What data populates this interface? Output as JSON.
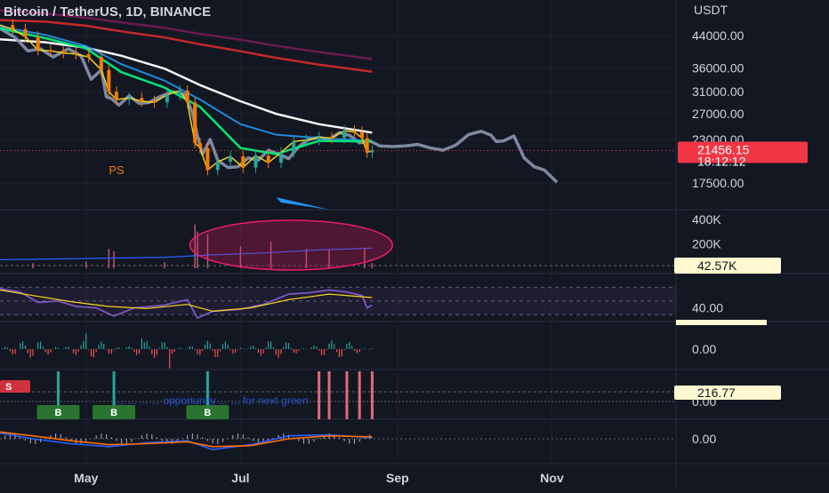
{
  "header": {
    "symbol_title": "Bitcoin / TetherUS, 1D, BINANCE"
  },
  "colors": {
    "background": "#131722",
    "text": "#d1d4dc",
    "price_line": "#8a96ad",
    "candle_up": "#26a69a",
    "candle_down": "#f57c00",
    "ma_white": "#f5f5f5",
    "ma_red": "#c62828",
    "ma_purple": "#6a1b4d",
    "ma_green": "#00e676",
    "ma_blue": "#2196f3",
    "ma_yellow": "#f9d71c",
    "volume_ellipse": "#e91e63",
    "rsi_line": "#7e57c2",
    "rsi_signal": "#f9d71c",
    "macd_line": "#2962ff",
    "signal_line": "#ff6d00",
    "price_badge": "#f23645",
    "label_badge": "#fff8d0"
  },
  "chart_data": [
    {
      "type": "line",
      "panel": "price",
      "title": "Bitcoin / TetherUS, 1D, BINANCE",
      "currency_label": "USDT",
      "yscale": "log",
      "ylim": [
        15000,
        52000
      ],
      "y_ticks": [
        44000,
        36000,
        31000,
        27000,
        23000,
        17500
      ],
      "y_tick_labels": [
        "44000.00",
        "36000.00",
        "31000.00",
        "27000.00",
        "23000.00",
        "17500.00"
      ],
      "x_tick_labels": [
        "May",
        "Jul",
        "Sep",
        "Nov"
      ],
      "x_ticks": [
        "2022-05-01",
        "2022-07-01",
        "2022-09-01",
        "2022-11-01"
      ],
      "xlim": [
        "2022-03-28",
        "2022-12-20"
      ],
      "last_price": "21456.15",
      "countdown": "18:12:12",
      "annotation": "PS",
      "series": [
        {
          "role": "projection_line",
          "dates": [
            "2022-03-28",
            "2022-04-03",
            "2022-04-08",
            "2022-04-13",
            "2022-04-18",
            "2022-04-24",
            "2022-04-29",
            "2022-05-03",
            "2022-05-07",
            "2022-05-09",
            "2022-05-11",
            "2022-05-14",
            "2022-05-18",
            "2022-05-22",
            "2022-05-26",
            "2022-05-30",
            "2022-06-04",
            "2022-06-09",
            "2022-06-12",
            "2022-06-14",
            "2022-06-16",
            "2022-06-19",
            "2022-06-22",
            "2022-06-26",
            "2022-06-30",
            "2022-07-04",
            "2022-07-08",
            "2022-07-12",
            "2022-07-16",
            "2022-07-20",
            "2022-07-24",
            "2022-07-28",
            "2022-08-01",
            "2022-08-05",
            "2022-08-09",
            "2022-08-13",
            "2022-08-17",
            "2022-08-21",
            "2022-08-25",
            "2022-08-30",
            "2022-09-04",
            "2022-09-09",
            "2022-09-14",
            "2022-09-19",
            "2022-09-24",
            "2022-09-29",
            "2022-10-04",
            "2022-10-08",
            "2022-10-10",
            "2022-10-13",
            "2022-10-17",
            "2022-10-21",
            "2022-10-25",
            "2022-10-29",
            "2022-11-03"
          ],
          "values": [
            46000,
            43500,
            40000,
            40500,
            38500,
            40500,
            38800,
            33500,
            35500,
            30000,
            29700,
            28500,
            30200,
            28800,
            29000,
            30000,
            31000,
            30500,
            27200,
            23500,
            21000,
            23000,
            20200,
            19300,
            19400,
            20500,
            20200,
            21500,
            21000,
            20400,
            22000,
            23000,
            23300,
            23000,
            24000,
            23600,
            22500,
            22800,
            22100,
            22000,
            22100,
            22300,
            21800,
            21500,
            22200,
            23700,
            24200,
            23600,
            22700,
            22800,
            23500,
            20500,
            19400,
            19000,
            17600
          ]
        },
        {
          "role": "close",
          "dates": [
            "2022-03-28",
            "2022-04-02",
            "2022-04-07",
            "2022-04-12",
            "2022-04-17",
            "2022-04-22",
            "2022-04-27",
            "2022-05-02",
            "2022-05-07",
            "2022-05-10",
            "2022-05-13",
            "2022-05-18",
            "2022-05-23",
            "2022-05-28",
            "2022-06-02",
            "2022-06-07",
            "2022-06-10",
            "2022-06-13",
            "2022-06-15",
            "2022-06-18",
            "2022-06-22",
            "2022-06-27",
            "2022-07-02",
            "2022-07-07",
            "2022-07-12",
            "2022-07-17",
            "2022-07-22",
            "2022-07-27",
            "2022-08-01",
            "2022-08-06",
            "2022-08-11",
            "2022-08-15",
            "2022-08-18",
            "2022-08-20",
            "2022-08-22"
          ],
          "values": [
            47000,
            45800,
            43700,
            40200,
            40000,
            39500,
            39200,
            38500,
            35500,
            31000,
            29500,
            29800,
            29200,
            29000,
            30400,
            31200,
            29000,
            22500,
            21800,
            19000,
            20000,
            20700,
            19300,
            20800,
            19900,
            21200,
            22700,
            22900,
            23300,
            23200,
            24300,
            24100,
            23200,
            21200,
            21456
          ]
        },
        {
          "role": "moving_average_white",
          "dates": [
            "2022-03-28",
            "2022-04-15",
            "2022-05-01",
            "2022-05-15",
            "2022-06-01",
            "2022-06-15",
            "2022-07-01",
            "2022-07-15",
            "2022-08-01",
            "2022-08-22"
          ],
          "values": [
            43000,
            42200,
            40800,
            38800,
            35800,
            32300,
            29200,
            27000,
            25300,
            24000
          ]
        },
        {
          "role": "moving_average_red",
          "dates": [
            "2022-03-28",
            "2022-04-15",
            "2022-05-01",
            "2022-05-15",
            "2022-06-01",
            "2022-06-15",
            "2022-07-01",
            "2022-07-15",
            "2022-08-01",
            "2022-08-22"
          ],
          "values": [
            48500,
            48000,
            46800,
            45200,
            43500,
            41700,
            39900,
            38300,
            36700,
            35100
          ]
        },
        {
          "role": "moving_average_purple",
          "dates": [
            "2022-03-28",
            "2022-04-15",
            "2022-05-01",
            "2022-05-15",
            "2022-06-01",
            "2022-06-15",
            "2022-07-01",
            "2022-07-15",
            "2022-08-01",
            "2022-08-22"
          ],
          "values": [
            51500,
            50500,
            49200,
            47800,
            46200,
            44500,
            42900,
            41300,
            39700,
            38000
          ]
        },
        {
          "role": "moving_average_blue",
          "dates": [
            "2022-03-28",
            "2022-04-15",
            "2022-05-01",
            "2022-05-15",
            "2022-06-01",
            "2022-06-15",
            "2022-07-01",
            "2022-07-15",
            "2022-08-01",
            "2022-08-22"
          ],
          "values": [
            46500,
            44200,
            41200,
            36800,
            33200,
            29500,
            25300,
            23700,
            23200,
            22800
          ]
        },
        {
          "role": "moving_average_green",
          "dates": [
            "2022-03-28",
            "2022-04-15",
            "2022-05-01",
            "2022-05-15",
            "2022-06-01",
            "2022-06-15",
            "2022-07-01",
            "2022-07-15",
            "2022-08-01",
            "2022-08-22"
          ],
          "values": [
            46000,
            43300,
            40600,
            35000,
            31800,
            28200,
            21800,
            21000,
            22800,
            22700
          ]
        }
      ]
    },
    {
      "type": "bar",
      "panel": "volume",
      "y_tick_labels": [
        "400K",
        "200K"
      ],
      "y_ticks": [
        400000,
        200000
      ],
      "ylim": [
        0,
        480000
      ],
      "last_value": "42.57K",
      "dates": [
        "2022-04-10",
        "2022-05-01",
        "2022-05-10",
        "2022-05-12",
        "2022-06-01",
        "2022-06-13",
        "2022-06-14",
        "2022-06-18",
        "2022-07-01",
        "2022-07-13",
        "2022-07-27",
        "2022-08-05",
        "2022-08-19",
        "2022-08-22"
      ],
      "values": [
        42000,
        55000,
        160000,
        140000,
        50000,
        360000,
        300000,
        280000,
        180000,
        220000,
        160000,
        150000,
        170000,
        42570
      ],
      "average": {
        "dates": [
          "2022-03-28",
          "2022-05-01",
          "2022-06-01",
          "2022-06-20",
          "2022-07-10",
          "2022-08-01",
          "2022-08-22"
        ],
        "values": [
          70000,
          80000,
          90000,
          110000,
          125000,
          150000,
          165000
        ]
      }
    },
    {
      "type": "line",
      "panel": "rsi",
      "y_tick_labels": [
        "40.00"
      ],
      "y_ticks": [
        40
      ],
      "ylim": [
        20,
        90
      ],
      "series": [
        {
          "role": "rsi",
          "dates": [
            "2022-03-28",
            "2022-04-05",
            "2022-04-12",
            "2022-04-20",
            "2022-04-27",
            "2022-05-05",
            "2022-05-12",
            "2022-05-20",
            "2022-06-01",
            "2022-06-10",
            "2022-06-14",
            "2022-06-20",
            "2022-07-01",
            "2022-07-10",
            "2022-07-20",
            "2022-07-28",
            "2022-08-05",
            "2022-08-12",
            "2022-08-18",
            "2022-08-20",
            "2022-08-22"
          ],
          "values": [
            68,
            63,
            48,
            50,
            42,
            40,
            28,
            40,
            44,
            52,
            25,
            35,
            38,
            45,
            60,
            62,
            66,
            63,
            58,
            40,
            44
          ]
        },
        {
          "role": "rsi_signal",
          "dates": [
            "2022-03-28",
            "2022-04-10",
            "2022-04-25",
            "2022-05-10",
            "2022-05-25",
            "2022-06-10",
            "2022-06-20",
            "2022-07-05",
            "2022-07-20",
            "2022-08-05",
            "2022-08-22"
          ],
          "values": [
            66,
            58,
            49,
            42,
            39,
            45,
            35,
            40,
            52,
            60,
            55
          ]
        }
      ]
    },
    {
      "type": "bar",
      "panel": "oscillator",
      "y_tick_labels": [
        "0.00"
      ],
      "y_ticks": [
        0
      ],
      "ylim": [
        -1,
        1
      ]
    },
    {
      "type": "bar",
      "panel": "signals",
      "y_tick_labels": [
        "0.00"
      ],
      "y_ticks": [
        0
      ],
      "last_value": "216.77",
      "text_overlay": "... ...   ...  ... opportunity ... ... for next green",
      "signal_markers": [
        {
          "label": "S",
          "date": "2022-03-30"
        },
        {
          "label": "B",
          "date": "2022-04-20"
        },
        {
          "label": "B",
          "date": "2022-05-12"
        },
        {
          "label": "B",
          "date": "2022-06-18"
        }
      ],
      "green_bar_dates": [
        "2022-04-20",
        "2022-05-12",
        "2022-06-18"
      ],
      "red_bar_dates": [
        "2022-08-01",
        "2022-08-05",
        "2022-08-12",
        "2022-08-17",
        "2022-08-22"
      ]
    },
    {
      "type": "line",
      "panel": "macd",
      "y_tick_labels": [
        "0.00"
      ],
      "y_ticks": [
        0
      ],
      "ylim": [
        -1,
        1
      ],
      "series": [
        {
          "role": "macd",
          "dates": [
            "2022-03-28",
            "2022-04-10",
            "2022-04-25",
            "2022-05-10",
            "2022-05-25",
            "2022-06-10",
            "2022-06-20",
            "2022-07-05",
            "2022-07-20",
            "2022-08-05",
            "2022-08-22"
          ],
          "values": [
            0.3,
            0.0,
            -0.25,
            -0.4,
            -0.2,
            -0.1,
            -0.55,
            -0.3,
            0.15,
            0.2,
            0.05
          ]
        },
        {
          "role": "signal",
          "dates": [
            "2022-03-28",
            "2022-04-10",
            "2022-04-25",
            "2022-05-10",
            "2022-05-25",
            "2022-06-10",
            "2022-06-20",
            "2022-07-05",
            "2022-07-20",
            "2022-08-05",
            "2022-08-22"
          ],
          "values": [
            0.35,
            0.15,
            -0.1,
            -0.3,
            -0.25,
            -0.15,
            -0.4,
            -0.35,
            0.0,
            0.15,
            0.1
          ]
        }
      ]
    }
  ]
}
